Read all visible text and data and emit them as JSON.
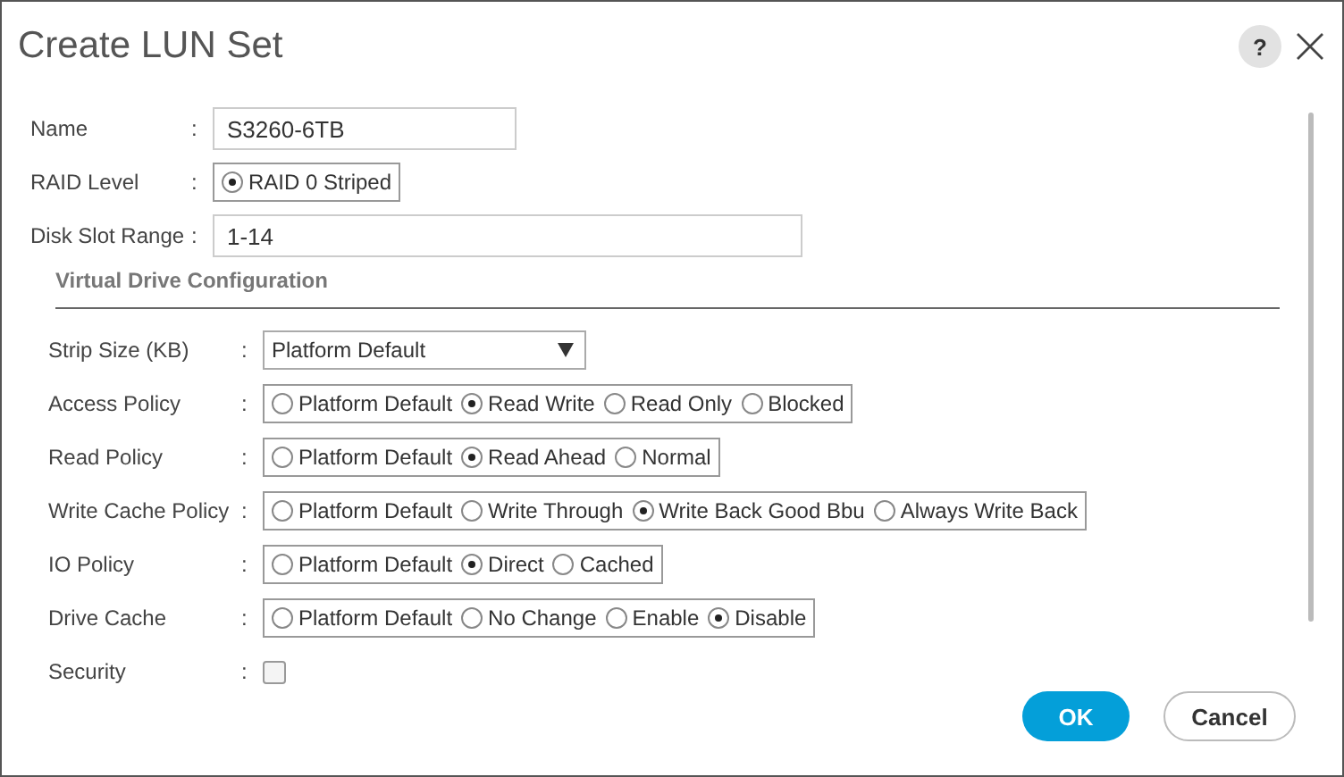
{
  "dialog": {
    "title": "Create LUN Set",
    "help_button": "?"
  },
  "fields": [
    {
      "label": "Name",
      "separator": ":",
      "kind": "text",
      "value": "S3260-6TB"
    },
    {
      "label": "RAID Level",
      "separator": ":",
      "kind": "radio",
      "options": [
        {
          "label": "RAID 0 Striped",
          "selected": true
        }
      ]
    },
    {
      "label": "Disk Slot Range",
      "separator": ":",
      "kind": "range",
      "value": "1-14"
    }
  ],
  "section": {
    "title": "Virtual Drive Configuration",
    "fields": [
      {
        "label": "Strip Size (KB)",
        "separator": ":",
        "kind": "select",
        "value": "Platform Default"
      },
      {
        "label": "Access Policy",
        "separator": ":",
        "kind": "radio",
        "options": [
          {
            "label": "Platform Default",
            "selected": false
          },
          {
            "label": "Read Write",
            "selected": true
          },
          {
            "label": "Read Only",
            "selected": false
          },
          {
            "label": "Blocked",
            "selected": false
          }
        ]
      },
      {
        "label": "Read Policy",
        "separator": ":",
        "kind": "radio",
        "options": [
          {
            "label": "Platform Default",
            "selected": false
          },
          {
            "label": "Read Ahead",
            "selected": true
          },
          {
            "label": "Normal",
            "selected": false
          }
        ]
      },
      {
        "label": "Write Cache Policy",
        "separator": ":",
        "kind": "radio",
        "options": [
          {
            "label": "Platform Default",
            "selected": false
          },
          {
            "label": "Write Through",
            "selected": false
          },
          {
            "label": "Write Back Good Bbu",
            "selected": true
          },
          {
            "label": "Always Write Back",
            "selected": false
          }
        ]
      },
      {
        "label": "IO Policy",
        "separator": ":",
        "kind": "radio",
        "options": [
          {
            "label": "Platform Default",
            "selected": false
          },
          {
            "label": "Direct",
            "selected": true
          },
          {
            "label": "Cached",
            "selected": false
          }
        ]
      },
      {
        "label": "Drive Cache",
        "separator": ":",
        "kind": "radio",
        "options": [
          {
            "label": "Platform Default",
            "selected": false
          },
          {
            "label": "No Change",
            "selected": false
          },
          {
            "label": "Enable",
            "selected": false
          },
          {
            "label": "Disable",
            "selected": true
          }
        ]
      },
      {
        "label": "Security",
        "separator": ":",
        "kind": "checkbox",
        "checked": false
      }
    ]
  },
  "buttons": [
    {
      "label": "OK",
      "kind": "primary"
    },
    {
      "label": "Cancel",
      "kind": "secondary"
    }
  ]
}
